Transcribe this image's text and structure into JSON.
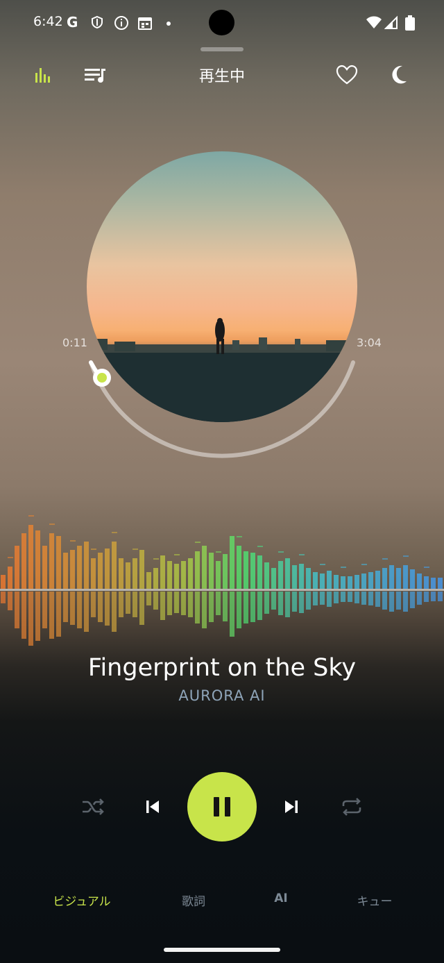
{
  "status_bar": {
    "time": "6:42",
    "icons": [
      "google-icon",
      "shield-icon",
      "info-icon",
      "calendar-icon",
      "dot-icon",
      "wifi-icon",
      "signal-icon",
      "battery-icon"
    ],
    "google_glyph": "G"
  },
  "header": {
    "title": "再生中",
    "left_icons": [
      "equalizer-icon",
      "playlist-icon"
    ],
    "right_icons": [
      "heart-icon",
      "moon-icon"
    ]
  },
  "player": {
    "elapsed": "0:11",
    "duration": "3:04",
    "progress": 0.06,
    "track_title": "Fingerprint on the Sky",
    "artist": "AURORA AI"
  },
  "controls": [
    "shuffle-icon",
    "previous-icon",
    "pause-icon",
    "next-icon",
    "repeat-icon"
  ],
  "tabs": [
    {
      "label": "ビジュアル",
      "active": true
    },
    {
      "label": "歌詞",
      "active": false
    },
    {
      "label": "AI",
      "active": false
    },
    {
      "label": "キュー",
      "active": false
    }
  ],
  "colors": {
    "accent": "#c8e44a",
    "artist_text": "#8ea4b8",
    "inactive_tab": "#7d8a96"
  }
}
